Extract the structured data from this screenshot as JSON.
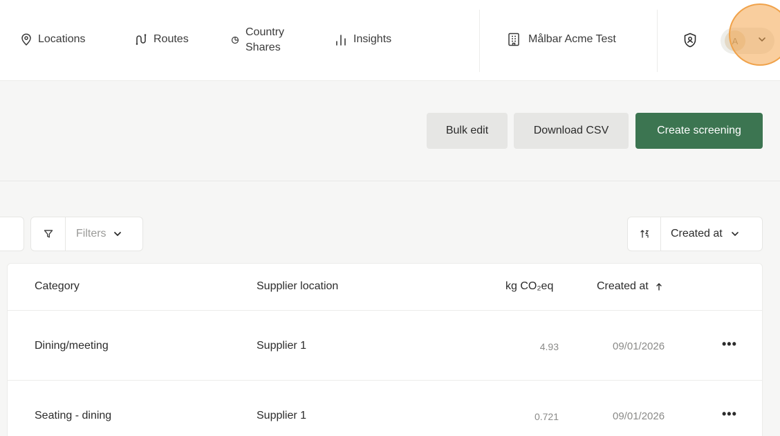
{
  "nav": {
    "locations": "Locations",
    "routes": "Routes",
    "country_shares_line1": "Country",
    "country_shares_line2": "Shares",
    "insights": "Insights"
  },
  "org": {
    "name": "Målbar Acme Test"
  },
  "user": {
    "initial": "A"
  },
  "actions": {
    "bulk_edit": "Bulk edit",
    "download_csv": "Download CSV",
    "create_screening": "Create screening"
  },
  "toolbar": {
    "filters_label": "Filters",
    "sort_label": "Created at"
  },
  "table": {
    "headers": {
      "category": "Category",
      "supplier_location": "Supplier location",
      "co2": "kg CO₂eq",
      "created_at": "Created at"
    },
    "rows": [
      {
        "category": "Dining/meeting",
        "supplier": "Supplier 1",
        "co2": "4.93",
        "created": "09/01/2026"
      },
      {
        "category": "Seating - dining",
        "supplier": "Supplier 1",
        "co2": "0.721",
        "created": "09/01/2026"
      }
    ]
  },
  "colors": {
    "accent": "#3c7551",
    "cursor_highlight": "#f0a24a"
  }
}
